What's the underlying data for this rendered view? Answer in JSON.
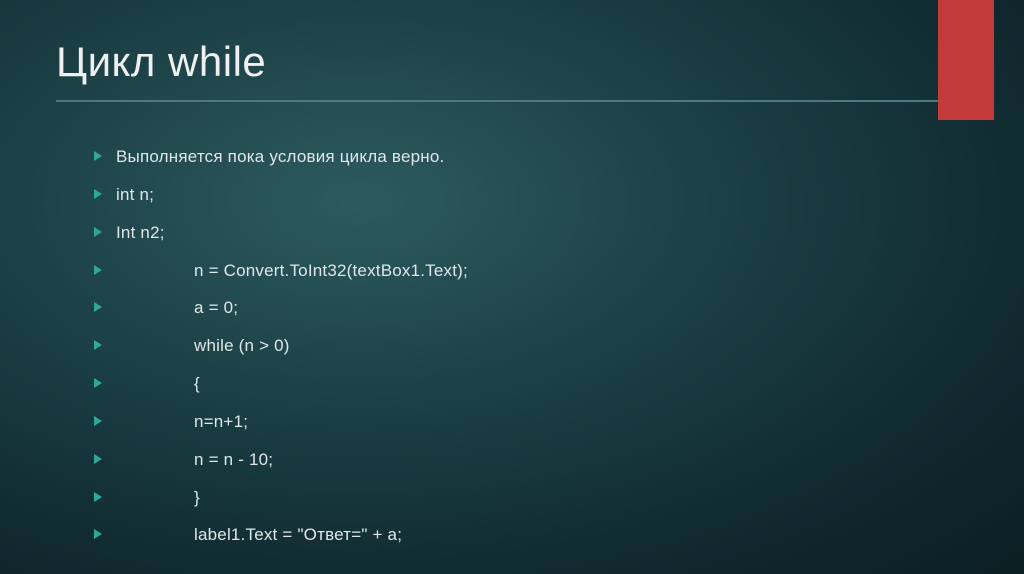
{
  "title": "Цикл while",
  "bullets": [
    {
      "text": "Выполняется пока условия цикла  верно.",
      "indent": false
    },
    {
      "text": "int n;",
      "indent": false
    },
    {
      "text": "Int n2;",
      "indent": false
    },
    {
      "text": "n = Convert.ToInt32(textBox1.Text);",
      "indent": true
    },
    {
      "text": "a = 0;",
      "indent": true
    },
    {
      "text": "while (n > 0)",
      "indent": true
    },
    {
      "text": "{",
      "indent": true
    },
    {
      "text": "n=n+1;",
      "indent": true
    },
    {
      "text": "n = n - 10;",
      "indent": true
    },
    {
      "text": "}",
      "indent": true
    },
    {
      "text": "label1.Text = \"Ответ=\" + a;",
      "indent": true
    }
  ]
}
